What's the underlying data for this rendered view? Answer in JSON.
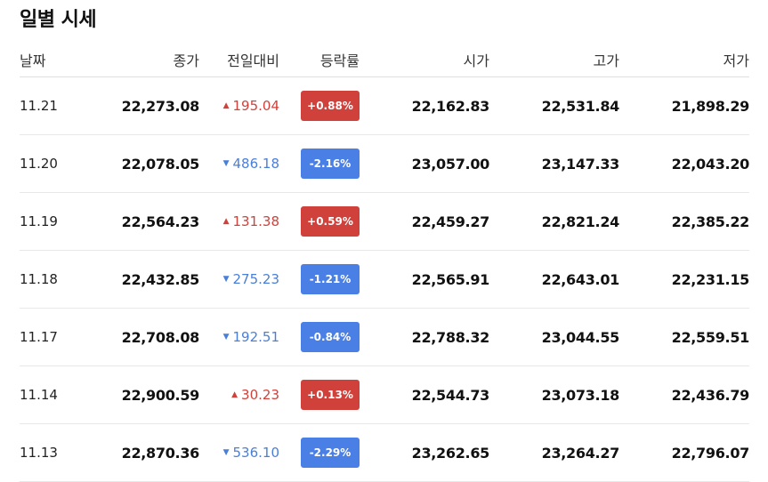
{
  "title": "일별 시세",
  "headers": {
    "date": "날짜",
    "close": "종가",
    "diff": "전일대비",
    "rate": "등락률",
    "open": "시가",
    "high": "고가",
    "low": "저가"
  },
  "colors": {
    "up": "#d0413b",
    "down": "#4a7fe6"
  },
  "rows": [
    {
      "date": "11.21",
      "close": "22,273.08",
      "dir": "up",
      "diff": "195.04",
      "rate": "+0.88%",
      "open": "22,162.83",
      "high": "22,531.84",
      "low": "21,898.29"
    },
    {
      "date": "11.20",
      "close": "22,078.05",
      "dir": "down",
      "diff": "486.18",
      "rate": "-2.16%",
      "open": "23,057.00",
      "high": "23,147.33",
      "low": "22,043.20"
    },
    {
      "date": "11.19",
      "close": "22,564.23",
      "dir": "up",
      "diff": "131.38",
      "rate": "+0.59%",
      "open": "22,459.27",
      "high": "22,821.24",
      "low": "22,385.22"
    },
    {
      "date": "11.18",
      "close": "22,432.85",
      "dir": "down",
      "diff": "275.23",
      "rate": "-1.21%",
      "open": "22,565.91",
      "high": "22,643.01",
      "low": "22,231.15"
    },
    {
      "date": "11.17",
      "close": "22,708.08",
      "dir": "down",
      "diff": "192.51",
      "rate": "-0.84%",
      "open": "22,788.32",
      "high": "23,044.55",
      "low": "22,559.51"
    },
    {
      "date": "11.14",
      "close": "22,900.59",
      "dir": "up",
      "diff": "30.23",
      "rate": "+0.13%",
      "open": "22,544.73",
      "high": "23,073.18",
      "low": "22,436.79"
    },
    {
      "date": "11.13",
      "close": "22,870.36",
      "dir": "down",
      "diff": "536.10",
      "rate": "-2.29%",
      "open": "23,262.65",
      "high": "23,264.27",
      "low": "22,796.07"
    }
  ]
}
